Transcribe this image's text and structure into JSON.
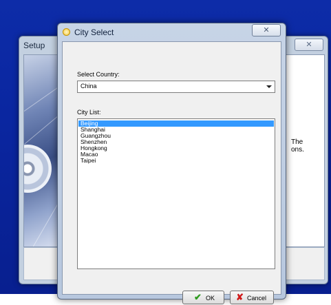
{
  "setup_window": {
    "title": "Setup",
    "close_glyph": "✕",
    "partial_text_line1": "The",
    "partial_text_line2": "ons."
  },
  "dialog": {
    "title": "City Select",
    "close_glyph": "✕",
    "country_label": "Select Country:",
    "country_value": "China",
    "city_list_label": "City List:",
    "cities": [
      "Beijing",
      "Shanghai",
      "Guangzhou",
      "Shenzhen",
      "Hongkong",
      "Macao",
      "Taipei"
    ],
    "selected_city": "Beijing",
    "ok_label": "OK",
    "cancel_label": "Cancel"
  },
  "icons": {
    "dialog_icon": "circle-icon",
    "ok_icon": "checkmark-icon",
    "cancel_icon": "x-icon"
  },
  "colors": {
    "desktop": "#0a26a0",
    "selection": "#3399ff",
    "ok_check": "#2e9b1e",
    "cancel_x": "#d01a1a"
  }
}
